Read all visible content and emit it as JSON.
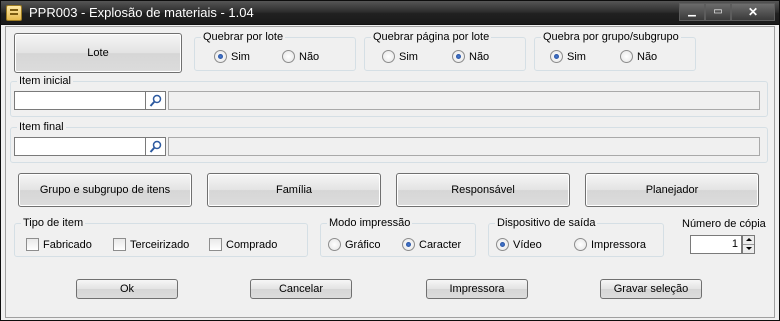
{
  "window": {
    "title": "PPR003 - Explosão de materiais - 1.04",
    "min_glyph": "▁",
    "max_glyph": "▭",
    "close_glyph": "✕"
  },
  "buttons": {
    "lote": "Lote",
    "grupo": "Grupo e subgrupo de itens",
    "familia": "Família",
    "responsavel": "Responsável",
    "planejador": "Planejador",
    "ok": "Ok",
    "cancelar": "Cancelar",
    "impressora": "Impressora",
    "gravar": "Gravar seleção"
  },
  "quebrar_lote": {
    "label": "Quebrar por lote",
    "options": [
      "Sim",
      "Não"
    ],
    "selected": "Sim"
  },
  "quebrar_pagina": {
    "label": "Quebrar página por lote",
    "options": [
      "Sim",
      "Não"
    ],
    "selected": "Não"
  },
  "quebra_grupo": {
    "label": "Quebra por grupo/subgrupo",
    "options": [
      "Sim",
      "Não"
    ],
    "selected": "Sim"
  },
  "item_inicial": {
    "label": "Item inicial",
    "value": "",
    "description": ""
  },
  "item_final": {
    "label": "Item final",
    "value": "",
    "description": ""
  },
  "tipo_item": {
    "label": "Tipo de item",
    "options": [
      "Fabricado",
      "Terceirizado",
      "Comprado"
    ]
  },
  "modo_impressao": {
    "label": "Modo impressão",
    "options": [
      "Gráfico",
      "Caracter"
    ],
    "selected": "Caracter"
  },
  "dispositivo": {
    "label": "Dispositivo de saída",
    "options": [
      "Vídeo",
      "Impressora"
    ],
    "selected": "Vídeo"
  },
  "copias": {
    "label": "Número de cópia",
    "value": "1"
  },
  "colors": {
    "titlebar": "#1a1a1a",
    "background": "#f0f0f0",
    "radio_dot": "#1b3f8a"
  }
}
